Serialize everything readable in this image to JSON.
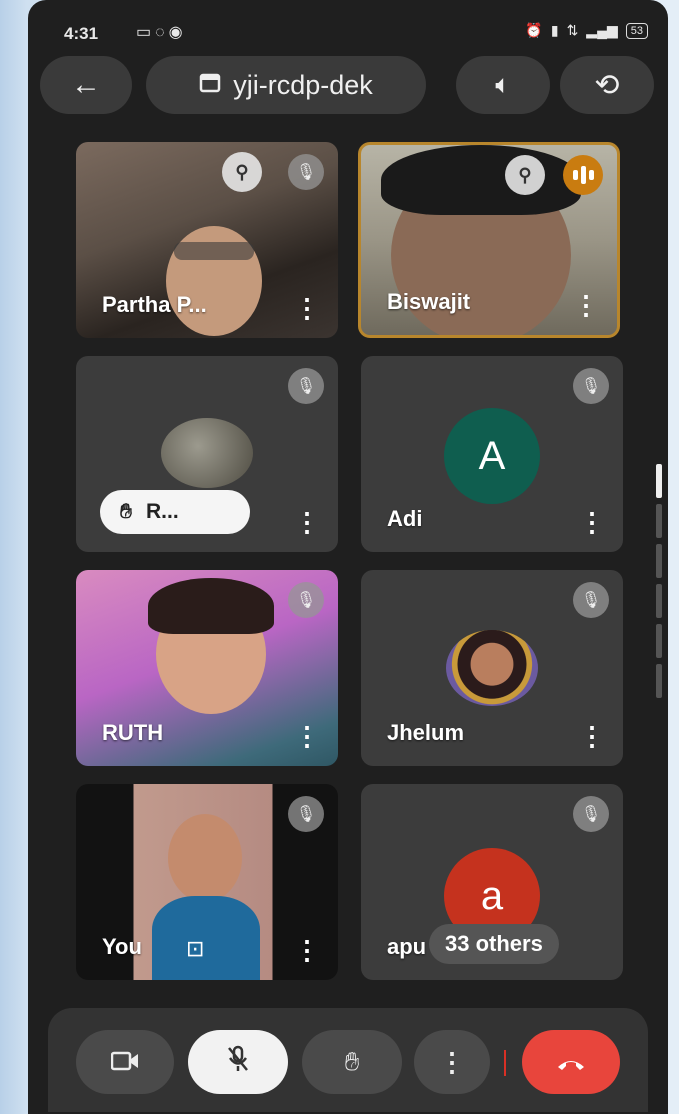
{
  "status_bar": {
    "time": "4:31",
    "left_icons": [
      "cast-icon",
      "whatsapp-icon",
      "chrome-icon"
    ],
    "right_icons": [
      "alarm-icon",
      "vibrate-icon",
      "data-speed-icon",
      "signal-icon"
    ],
    "battery": "53"
  },
  "header": {
    "meeting_code": "yji-rcdp-dek"
  },
  "tiles": [
    {
      "name": "Partha P...",
      "pinned": true,
      "mic_muted": true
    },
    {
      "name": "Biswajit",
      "pinned": true,
      "speaking": true
    },
    {
      "name": "R...",
      "hand_raised": true,
      "mic_muted": true
    },
    {
      "name": "Adi",
      "avatar_letter": "A",
      "avatar_color": "#0f5e4f",
      "mic_muted": true
    },
    {
      "name": "RUTH",
      "mic_muted": true
    },
    {
      "name": "Jhelum",
      "mic_muted": true
    },
    {
      "name": "You",
      "mic_muted": true
    },
    {
      "name": "apu",
      "avatar_letter": "a",
      "avatar_color": "#c5321e",
      "others_label": "33 others",
      "mic_muted": true
    }
  ],
  "controls": {
    "camera": "camera-icon",
    "mic": "mic-off-icon",
    "raise_hand": "hand-icon",
    "more": "more-vert-icon",
    "end_call": "call-end-icon"
  }
}
